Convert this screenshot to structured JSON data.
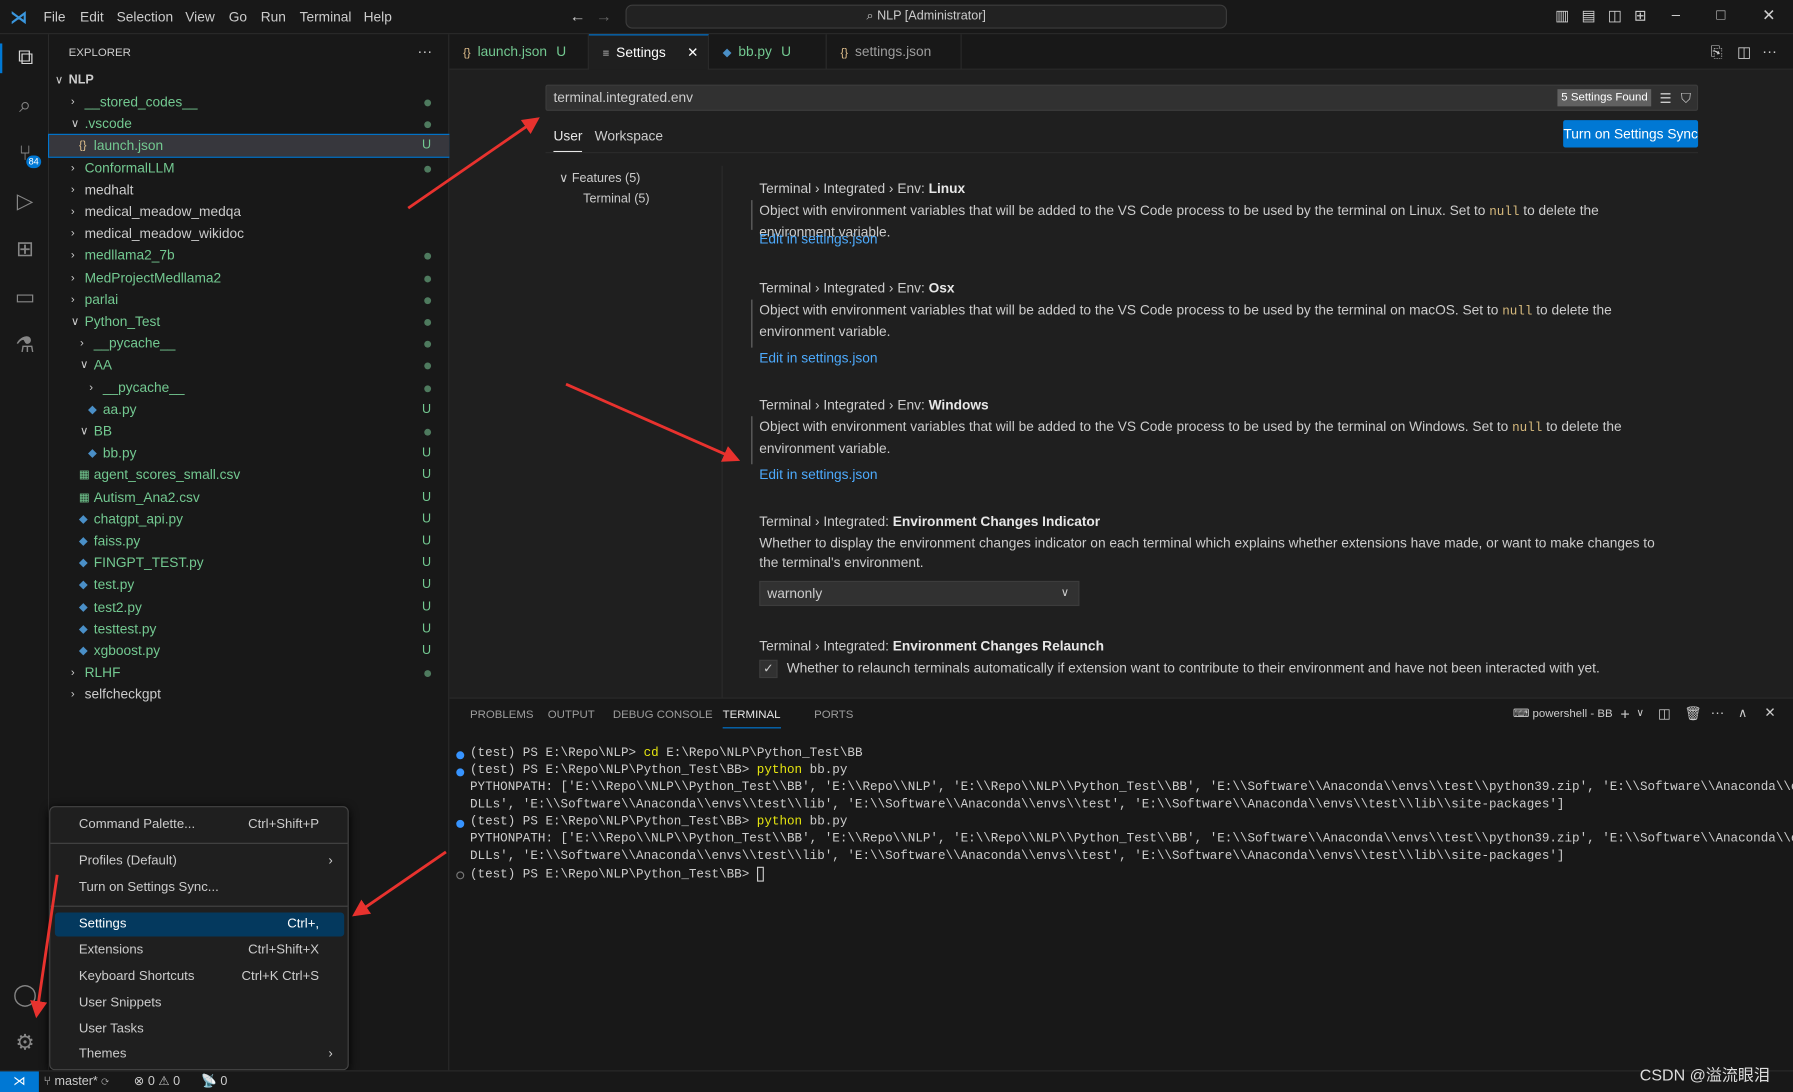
{
  "title": {
    "menus": [
      "File",
      "Edit",
      "Selection",
      "View",
      "Go",
      "Run",
      "Terminal",
      "Help"
    ],
    "command_center": "NLP [Administrator]"
  },
  "explorer": {
    "header": "EXPLORER",
    "root": "NLP",
    "items": [
      {
        "label": "__stored_codes__",
        "level": 1,
        "type": "folder",
        "open": false,
        "status": "dot",
        "color": "green"
      },
      {
        "label": ".vscode",
        "level": 1,
        "type": "folder",
        "open": true,
        "status": "dot",
        "color": "green"
      },
      {
        "label": "launch.json",
        "level": 2,
        "type": "json",
        "status": "U",
        "color": "green",
        "selected": true
      },
      {
        "label": "ConformalLLM",
        "level": 1,
        "type": "folder",
        "open": false,
        "status": "dot",
        "color": "green"
      },
      {
        "label": "medhalt",
        "level": 1,
        "type": "folder",
        "open": false,
        "status": "",
        "color": "white"
      },
      {
        "label": "medical_meadow_medqa",
        "level": 1,
        "type": "folder",
        "open": false,
        "status": "",
        "color": "white"
      },
      {
        "label": "medical_meadow_wikidoc",
        "level": 1,
        "type": "folder",
        "open": false,
        "status": "",
        "color": "white"
      },
      {
        "label": "medllama2_7b",
        "level": 1,
        "type": "folder",
        "open": false,
        "status": "dot",
        "color": "green"
      },
      {
        "label": "MedProjectMedllama2",
        "level": 1,
        "type": "folder",
        "open": false,
        "status": "dot",
        "color": "green"
      },
      {
        "label": "parlai",
        "level": 1,
        "type": "folder",
        "open": false,
        "status": "dot",
        "color": "green"
      },
      {
        "label": "Python_Test",
        "level": 1,
        "type": "folder",
        "open": true,
        "status": "dot",
        "color": "green"
      },
      {
        "label": "__pycache__",
        "level": 2,
        "type": "folder",
        "open": false,
        "status": "dot",
        "color": "green"
      },
      {
        "label": "AA",
        "level": 2,
        "type": "folder",
        "open": true,
        "status": "dot",
        "color": "green"
      },
      {
        "label": "__pycache__",
        "level": 3,
        "type": "folder",
        "open": false,
        "status": "dot",
        "color": "green"
      },
      {
        "label": "aa.py",
        "level": 3,
        "type": "py",
        "status": "U",
        "color": "green"
      },
      {
        "label": "BB",
        "level": 2,
        "type": "folder",
        "open": true,
        "status": "dot",
        "color": "green"
      },
      {
        "label": "bb.py",
        "level": 3,
        "type": "py",
        "status": "U",
        "color": "green"
      },
      {
        "label": "agent_scores_small.csv",
        "level": 2,
        "type": "csv",
        "status": "U",
        "color": "green"
      },
      {
        "label": "Autism_Ana2.csv",
        "level": 2,
        "type": "csv",
        "status": "U",
        "color": "green"
      },
      {
        "label": "chatgpt_api.py",
        "level": 2,
        "type": "py",
        "status": "U",
        "color": "green"
      },
      {
        "label": "faiss.py",
        "level": 2,
        "type": "py",
        "status": "U",
        "color": "green"
      },
      {
        "label": "FINGPT_TEST.py",
        "level": 2,
        "type": "py",
        "status": "U",
        "color": "green"
      },
      {
        "label": "test.py",
        "level": 2,
        "type": "py",
        "status": "U",
        "color": "green"
      },
      {
        "label": "test2.py",
        "level": 2,
        "type": "py",
        "status": "U",
        "color": "green"
      },
      {
        "label": "testtest.py",
        "level": 2,
        "type": "py",
        "status": "U",
        "color": "green"
      },
      {
        "label": "xgboost.py",
        "level": 2,
        "type": "py",
        "status": "U",
        "color": "green"
      },
      {
        "label": "RLHF",
        "level": 1,
        "type": "folder",
        "open": false,
        "status": "dot",
        "color": "green"
      },
      {
        "label": "selfcheckgpt",
        "level": 1,
        "type": "folder",
        "open": false,
        "status": "",
        "color": "white"
      }
    ]
  },
  "tabs": [
    {
      "label": "launch.json",
      "status": "U"
    },
    {
      "label": "Settings",
      "status": ""
    },
    {
      "label": "bb.py",
      "status": "U"
    },
    {
      "label": "settings.json",
      "status": ""
    }
  ],
  "settings": {
    "query": "terminal.integrated.env",
    "found": "5 Settings Found",
    "sync_button": "Turn on Settings Sync",
    "scope_tabs": [
      "User",
      "Workspace"
    ],
    "toc": [
      "Features (5)",
      "Terminal (5)"
    ],
    "entries": [
      {
        "prefix": "Terminal › Integrated › Env: ",
        "name": "Linux",
        "desc_a": "Object with environment variables that will be added to the VS Code process to be used by the terminal on Linux. Set to ",
        "code": "null",
        "desc_b": " to delete the environment variable.",
        "link": "Edit in settings.json"
      },
      {
        "prefix": "Terminal › Integrated › Env: ",
        "name": "Osx",
        "desc_a": "Object with environment variables that will be added to the VS Code process to be used by the terminal on macOS. Set to ",
        "code": "null",
        "desc_b": " to delete the environment variable.",
        "link": "Edit in settings.json"
      },
      {
        "prefix": "Terminal › Integrated › Env: ",
        "name": "Windows",
        "desc_a": "Object with environment variables that will be added to the VS Code process to be used by the terminal on Windows. Set to ",
        "code": "null",
        "desc_b": " to delete the environment variable.",
        "link": "Edit in settings.json"
      },
      {
        "prefix": "Terminal › Integrated: ",
        "name": "Environment Changes Indicator",
        "desc_a": "Whether to display the environment changes indicator on each terminal which explains whether extensions have made, or want to make changes to the terminal's environment.",
        "select": "warnonly"
      },
      {
        "prefix": "Terminal › Integrated: ",
        "name": "Environment Changes Relaunch",
        "desc_a": "Whether to relaunch terminals automatically if extension want to contribute to their environment and have not been interacted with yet.",
        "checked": true
      }
    ]
  },
  "panel": {
    "tabs": [
      "PROBLEMS",
      "OUTPUT",
      "DEBUG CONSOLE",
      "TERMINAL",
      "PORTS"
    ],
    "active": "TERMINAL",
    "terminal_name": "powershell - BB",
    "lines": [
      {
        "dot": "blue",
        "prompt": "(test) PS E:\\Repo\\NLP> ",
        "cmd": "cd",
        "rest": " E:\\Repo\\NLP\\Python_Test\\BB"
      },
      {
        "dot": "blue",
        "prompt": "(test) PS E:\\Repo\\NLP\\Python_Test\\BB> ",
        "cmd": "python",
        "rest": " bb.py"
      },
      {
        "text": "PYTHONPATH: ['E:\\\\Repo\\\\NLP\\\\Python_Test\\\\BB', 'E:\\\\Repo\\\\NLP', 'E:\\\\Repo\\\\NLP\\\\Python_Test\\\\BB', 'E:\\\\Software\\\\Anaconda\\\\envs\\\\test\\\\python39.zip', 'E:\\\\Software\\\\Anaconda\\\\envs\\\\test\\\\"
      },
      {
        "text": "DLLs', 'E:\\\\Software\\\\Anaconda\\\\envs\\\\test\\\\lib', 'E:\\\\Software\\\\Anaconda\\\\envs\\\\test', 'E:\\\\Software\\\\Anaconda\\\\envs\\\\test\\\\lib\\\\site-packages']"
      },
      {
        "dot": "blue",
        "prompt": "(test) PS E:\\Repo\\NLP\\Python_Test\\BB> ",
        "cmd": "python",
        "rest": " bb.py"
      },
      {
        "text": "PYTHONPATH: ['E:\\\\Repo\\\\NLP\\\\Python_Test\\\\BB', 'E:\\\\Repo\\\\NLP', 'E:\\\\Repo\\\\NLP\\\\Python_Test\\\\BB', 'E:\\\\Software\\\\Anaconda\\\\envs\\\\test\\\\python39.zip', 'E:\\\\Software\\\\Anaconda\\\\envs\\\\test\\\\"
      },
      {
        "text": "DLLs', 'E:\\\\Software\\\\Anaconda\\\\envs\\\\test\\\\lib', 'E:\\\\Software\\\\Anaconda\\\\envs\\\\test', 'E:\\\\Software\\\\Anaconda\\\\envs\\\\test\\\\lib\\\\site-packages']"
      },
      {
        "dot": "hollow",
        "prompt": "(test) PS E:\\Repo\\NLP\\Python_Test\\BB> ",
        "cmd": "",
        "rest": ""
      }
    ]
  },
  "context_menu": {
    "items": [
      {
        "label": "Command Palette...",
        "key": "Ctrl+Shift+P"
      },
      {
        "label": "Profiles (Default)",
        "key": "",
        "submenu": true
      },
      {
        "label": "Turn on Settings Sync...",
        "key": ""
      },
      {
        "label": "Settings",
        "key": "Ctrl+,",
        "highlight": true
      },
      {
        "label": "Extensions",
        "key": "Ctrl+Shift+X"
      },
      {
        "label": "Keyboard Shortcuts",
        "key": "Ctrl+K Ctrl+S"
      },
      {
        "label": "User Snippets",
        "key": ""
      },
      {
        "label": "User Tasks",
        "key": ""
      },
      {
        "label": "Themes",
        "key": "",
        "submenu": true
      }
    ]
  },
  "status": {
    "branch": "master*",
    "errors": "0",
    "warnings": "0",
    "ports": "0"
  },
  "watermark": "CSDN @溢流眼泪",
  "colors": {
    "accent": "#0078d4",
    "untracked": "#73c991",
    "annotation_arrow": "#e8322e"
  }
}
